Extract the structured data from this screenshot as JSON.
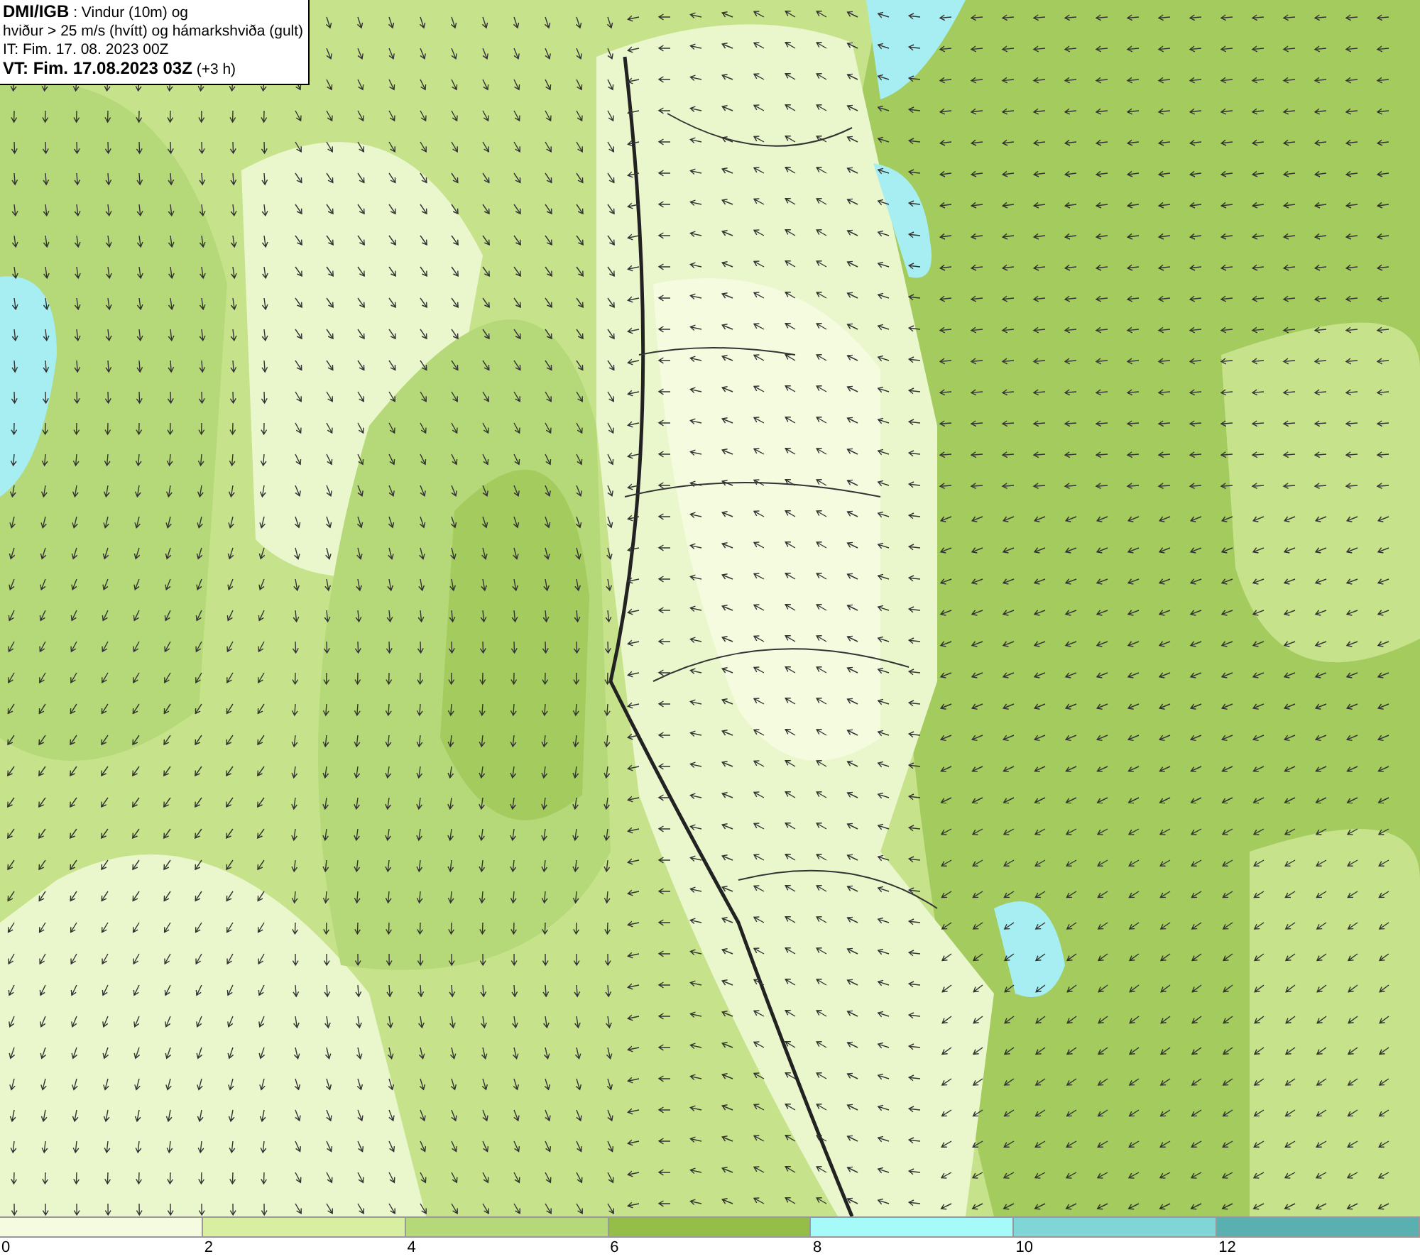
{
  "info_box": {
    "lines": [
      "**DMI/IGB** : Vindur (10m) og",
      "hviður > 25 m/s (hvítt) og hámarkshviða (gult)",
      "IT: Fim. 17. 08. 2023 00Z",
      "**VT: Fim. 17.08.2023 03Z** (+3 h)"
    ]
  },
  "legend": [
    {
      "label": "0",
      "color": "#f4fbdf"
    },
    {
      "label": "2",
      "color": "#d8efa2"
    },
    {
      "label": "4",
      "color": "#b5d978"
    },
    {
      "label": "6",
      "color": "#94be48"
    },
    {
      "label": "8",
      "color": "#a6fafa"
    },
    {
      "label": "10",
      "color": "#80d6d6"
    },
    {
      "label": "12",
      "color": "#5ab0b0"
    }
  ]
}
